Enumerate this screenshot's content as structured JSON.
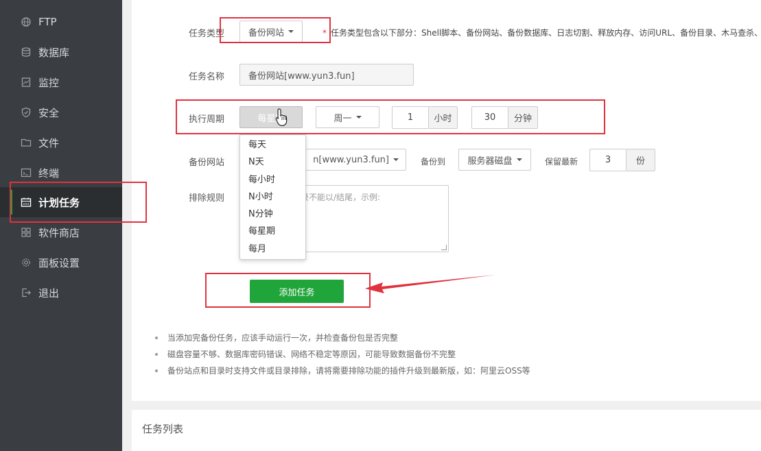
{
  "sidebar": {
    "items": [
      {
        "label": "FTP",
        "icon": "globe-icon"
      },
      {
        "label": "数据库",
        "icon": "database-icon"
      },
      {
        "label": "监控",
        "icon": "monitor-icon"
      },
      {
        "label": "安全",
        "icon": "shield-icon"
      },
      {
        "label": "文件",
        "icon": "folder-icon"
      },
      {
        "label": "终端",
        "icon": "terminal-icon"
      },
      {
        "label": "计划任务",
        "icon": "calendar-icon",
        "active": true
      },
      {
        "label": "软件商店",
        "icon": "grid-icon"
      },
      {
        "label": "面板设置",
        "icon": "gear-icon"
      },
      {
        "label": "退出",
        "icon": "logout-icon"
      }
    ]
  },
  "form": {
    "task_type": {
      "label": "任务类型",
      "value": "备份网站",
      "required_mark": "*",
      "hint": "任务类型包含以下部分：Shell脚本、备份网站、备份数据库、日志切割、释放内存、访问URL、备份目录、木马查杀、同步"
    },
    "task_name": {
      "label": "任务名称",
      "value": "备份网站[www.yun3.fun]"
    },
    "period": {
      "label": "执行周期",
      "type_value": "每星期",
      "weekday_value": "周一",
      "hour_value": "1",
      "hour_unit": "小时",
      "minute_value": "30",
      "minute_unit": "分钟",
      "options": [
        "每天",
        "N天",
        "每小时",
        "N小时",
        "N分钟",
        "每星期",
        "每月"
      ]
    },
    "backup_site": {
      "label": "备份网站",
      "value": "n[www.yun3.fun]",
      "backup_to_label": "备份到",
      "backup_to_value": "服务器磁盘",
      "keep_label": "保留最新",
      "keep_value": "3",
      "keep_unit": "份"
    },
    "exclude": {
      "label": "排除规则",
      "placeholder": "录不能以/结尾，示例:"
    },
    "submit_label": "添加任务"
  },
  "notes": [
    "当添加完备份任务，应该手动运行一次，并检查备份包是否完整",
    "磁盘容量不够、数据库密码错误、网络不稳定等原因，可能导致数据备份不完整",
    "备份站点和目录时支持文件或目录排除，请将需要排除功能的插件升级到最新版，如：阿里云OSS等"
  ],
  "task_list_title": "任务列表",
  "colors": {
    "sidebar": "#3a3e42",
    "accent": "#20a53a",
    "annotation": "#e0323e"
  }
}
